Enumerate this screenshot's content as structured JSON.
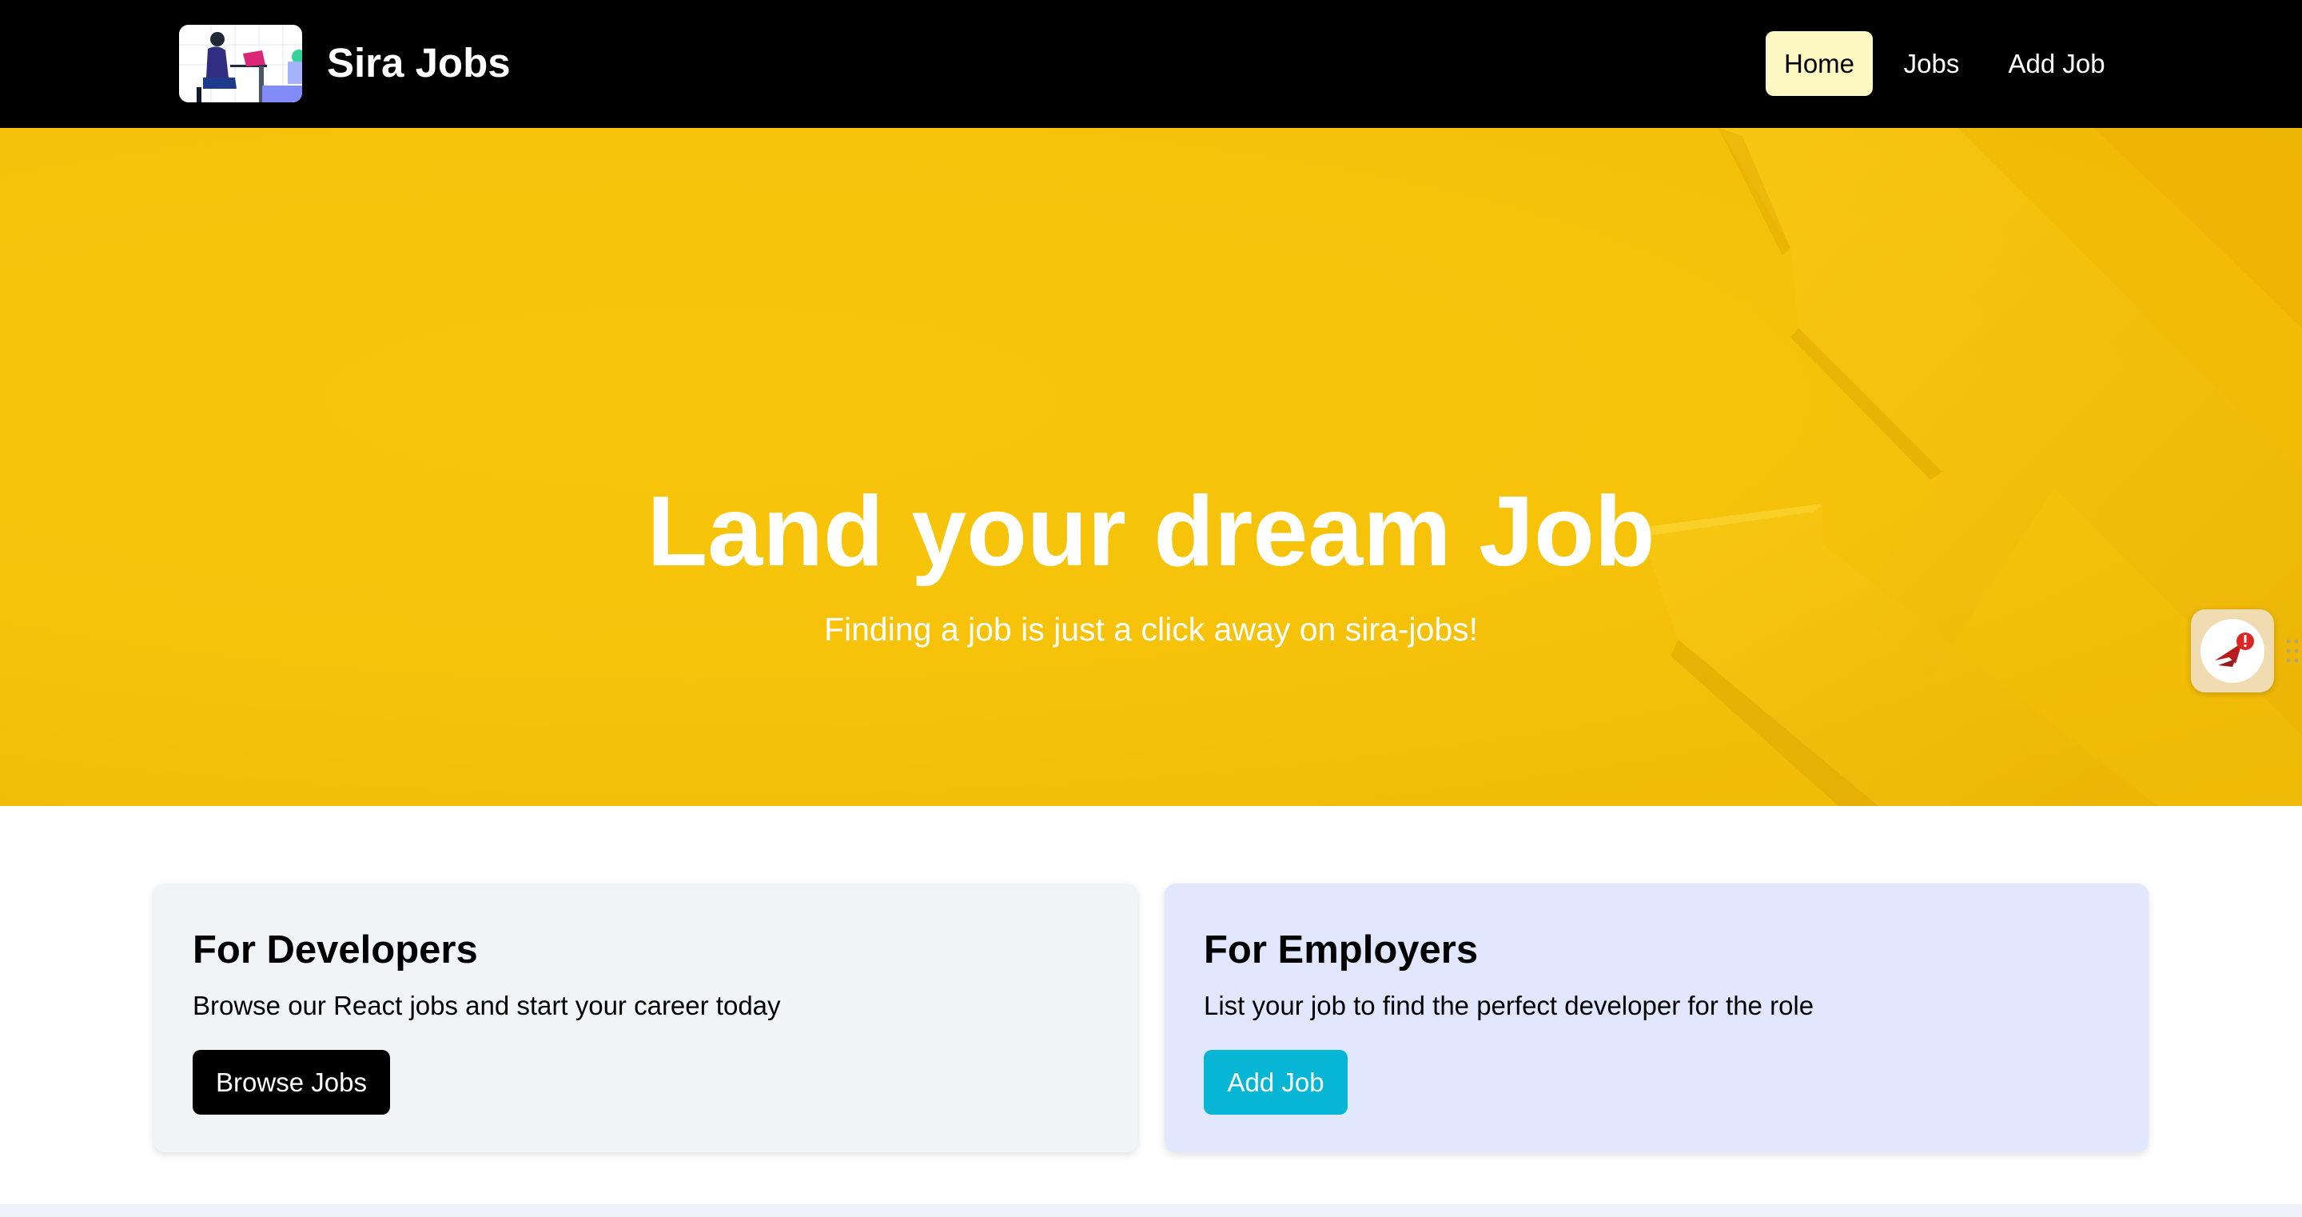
{
  "navbar": {
    "brand": "Sira Jobs",
    "links": [
      {
        "label": "Home",
        "active": true
      },
      {
        "label": "Jobs",
        "active": false
      },
      {
        "label": "Add Job",
        "active": false
      }
    ]
  },
  "hero": {
    "title": "Land your dream Job",
    "subtitle": "Finding a job is just a click away on sira-jobs!"
  },
  "cards": {
    "developers": {
      "title": "For Developers",
      "text": "Browse our React jobs and start your career today",
      "button": "Browse Jobs"
    },
    "employers": {
      "title": "For Employers",
      "text": "List your job to find the perfect developer for the role",
      "button": "Add Job"
    }
  },
  "colors": {
    "navbar_bg": "#000000",
    "active_link_bg": "#fef9c3",
    "hero_bg": "#f5c10a",
    "dev_card_bg": "#f3f4f6",
    "emp_card_bg": "#e0e7ff",
    "browse_button_bg": "#000000",
    "add_button_bg": "#06b6d4"
  },
  "icons": [
    "logo-illustration",
    "extension-widget-icon",
    "drag-handle-icon"
  ]
}
